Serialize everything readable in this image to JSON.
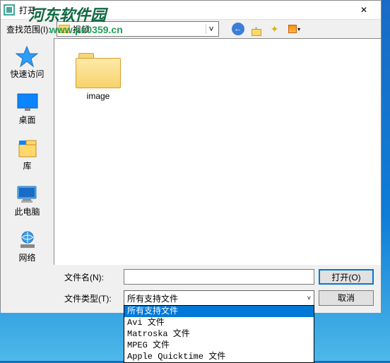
{
  "titlebar": {
    "title": "打开",
    "close_glyph": "✕"
  },
  "toprow": {
    "label": "查找范围(I):",
    "path": "视频",
    "dropdown_glyph": "˅",
    "back_glyph": "←",
    "view_arrow": "▾"
  },
  "sidebar": {
    "items": [
      {
        "label": "快速访问"
      },
      {
        "label": "桌面"
      },
      {
        "label": "库"
      },
      {
        "label": "此电脑"
      },
      {
        "label": "网络"
      }
    ]
  },
  "content": {
    "folders": [
      {
        "name": "image"
      }
    ]
  },
  "bottom": {
    "filename_label": "文件名(N):",
    "filename_value": "",
    "filetype_label": "文件类型(T):",
    "filetype_selected": "所有支持文件",
    "filetype_options": [
      "所有支持文件",
      "Avi 文件",
      "Matroska 文件",
      "MPEG 文件",
      "Apple Quicktime 文件"
    ],
    "open_btn": "打开(O)",
    "cancel_btn": "取消",
    "combo_arrow": "˅"
  },
  "watermark": {
    "line1": "河东软件园",
    "line2": "www.pc0359.cn"
  }
}
